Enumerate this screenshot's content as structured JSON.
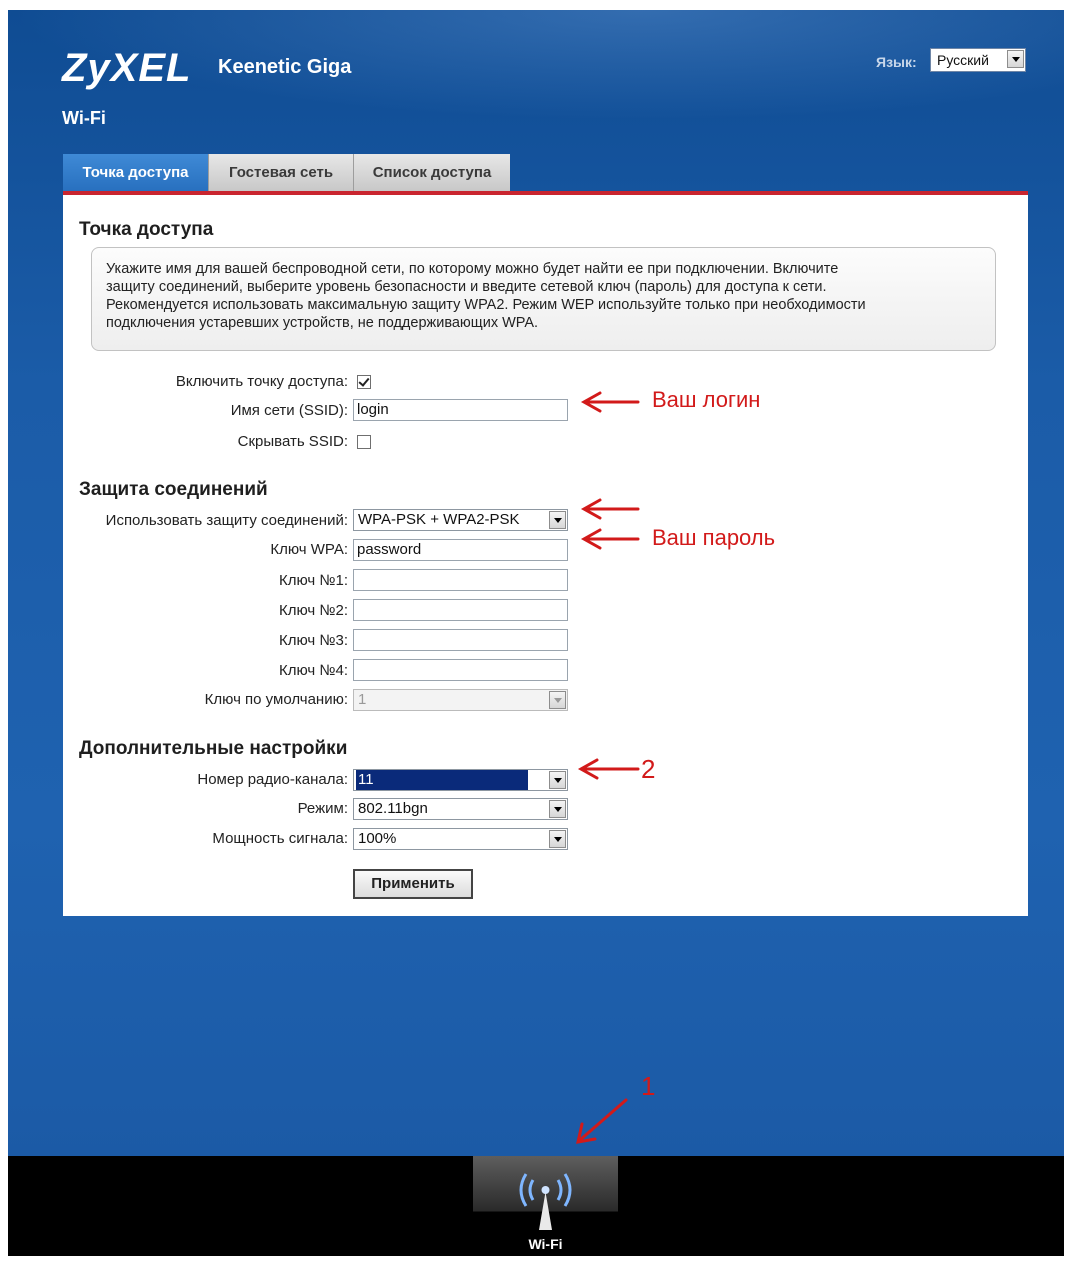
{
  "header": {
    "brand": "ZyXEL",
    "model": "Keenetic Giga",
    "language_label": "Язык:",
    "language_value": "Русский"
  },
  "page_title": "Wi-Fi",
  "tabs": [
    {
      "label": "Точка доступа",
      "active": true
    },
    {
      "label": "Гостевая сеть",
      "active": false
    },
    {
      "label": "Список доступа",
      "active": false
    }
  ],
  "access_point": {
    "title": "Точка доступа",
    "info_lines": [
      "Укажите имя для вашей беспроводной сети, по которому можно будет найти ее при подключении. Включите",
      "защиту соединений, выберите уровень безопасности и введите сетевой ключ (пароль) для доступа к сети.",
      "Рекомендуется использовать максимальную защиту WPA2. Режим WEP используйте только при необходимости",
      "подключения устаревших устройств, не поддерживающих WPA."
    ],
    "enable_label": "Включить точку доступа:",
    "enable_checked": true,
    "ssid_label": "Имя сети (SSID):",
    "ssid_value": "login",
    "hide_label": "Скрывать SSID:",
    "hide_checked": false
  },
  "security": {
    "title": "Защита соединений",
    "mode_label": "Использовать защиту соединений:",
    "mode_value": "WPA-PSK + WPA2-PSK",
    "wpa_label": "Ключ WPA:",
    "wpa_value": "password",
    "key1_label": "Ключ №1:",
    "key2_label": "Ключ №2:",
    "key3_label": "Ключ №3:",
    "key4_label": "Ключ №4:",
    "default_key_label": "Ключ по умолчанию:",
    "default_key_value": "1"
  },
  "advanced": {
    "title": "Дополнительные настройки",
    "channel_label": "Номер радио-канала:",
    "channel_value": "11",
    "mode_label": "Режим:",
    "mode_value": "802.11bgn",
    "power_label": "Мощность сигнала:",
    "power_value": "100%"
  },
  "apply_button": "Применить",
  "annotations": {
    "login": "Ваш логин",
    "password": "Ваш пароль",
    "step2": "2",
    "step1": "1"
  },
  "bottom_nav": {
    "wifi_label": "Wi-Fi",
    "icon": "wifi-tower-icon"
  },
  "colors": {
    "accent_red": "#c9252f",
    "annotation_red": "#d21a1a",
    "background_blue": "#1b5ca8",
    "tab_active": "#2870bf"
  }
}
